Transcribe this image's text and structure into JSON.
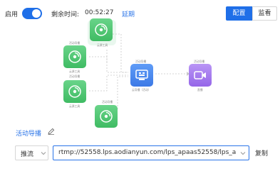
{
  "topbar": {
    "enable_label": "启用",
    "enabled": true,
    "remaining_label": "剩余时间:",
    "remaining_time": "00:52:27",
    "extend_label": "延期",
    "tabs": [
      {
        "label": "配置",
        "active": true
      },
      {
        "label": "监看",
        "active": false
      }
    ]
  },
  "diagram": {
    "nodes": {
      "source_top": {
        "caption": "云源工具"
      },
      "source_2": {
        "title": "活动导播",
        "caption": "云源工具"
      },
      "source_3": {
        "title": "活动导播",
        "caption": "云源工具"
      },
      "source_4": {
        "title": "活动导播"
      },
      "switcher": {
        "title": "活动导播",
        "caption": "云导播（活动）"
      },
      "output": {
        "title": "活动导播",
        "caption": "直播"
      }
    },
    "colors": {
      "source": "#4cc46f",
      "switcher": "#3c79e6",
      "output": "#9566e8",
      "line": "#bfbfbf"
    }
  },
  "bottom": {
    "guide_link": "活动导播",
    "push_mode": "推流",
    "stream_url": "rtmp://52558.lps.aodianyun.com/lps_apaas52558/lps_apaas52558_2",
    "copy_label": "复制"
  },
  "colors": {
    "accent": "#1f6fe8",
    "link": "#2a74e8"
  }
}
